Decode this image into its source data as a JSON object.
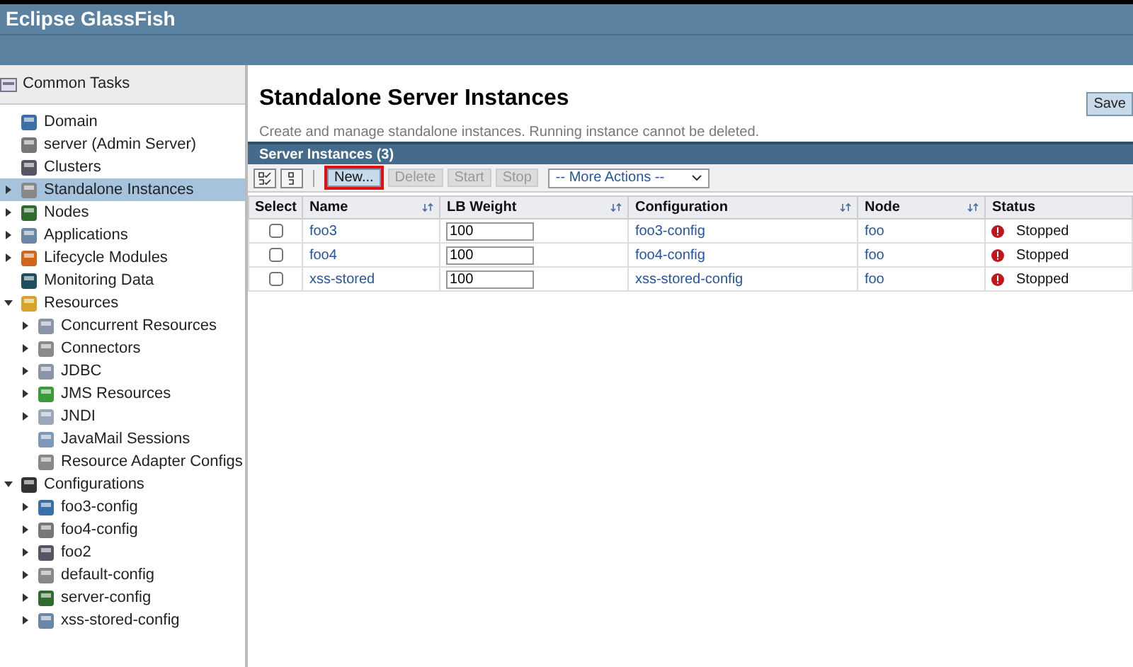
{
  "header": {
    "title": "Eclipse GlassFish"
  },
  "sidebar": {
    "title": "Common Tasks",
    "items": [
      {
        "label": "Domain",
        "kind": "leaf",
        "selected": false
      },
      {
        "label": "server (Admin Server)",
        "kind": "leaf",
        "selected": false
      },
      {
        "label": "Clusters",
        "kind": "leaf",
        "selected": false
      },
      {
        "label": "Standalone Instances",
        "kind": "node",
        "expanded": false,
        "selected": true
      },
      {
        "label": "Nodes",
        "kind": "node",
        "expanded": false,
        "selected": false
      },
      {
        "label": "Applications",
        "kind": "node",
        "expanded": false,
        "selected": false
      },
      {
        "label": "Lifecycle Modules",
        "kind": "node",
        "expanded": false,
        "selected": false
      },
      {
        "label": "Monitoring Data",
        "kind": "leaf",
        "selected": false
      },
      {
        "label": "Resources",
        "kind": "node",
        "expanded": true,
        "selected": false,
        "children": [
          {
            "label": "Concurrent Resources",
            "kind": "node",
            "expanded": false,
            "selected": false
          },
          {
            "label": "Connectors",
            "kind": "node",
            "expanded": false,
            "selected": false
          },
          {
            "label": "JDBC",
            "kind": "node",
            "expanded": false,
            "selected": false
          },
          {
            "label": "JMS Resources",
            "kind": "node",
            "expanded": false,
            "selected": false
          },
          {
            "label": "JNDI",
            "kind": "node",
            "expanded": false,
            "selected": false
          },
          {
            "label": "JavaMail Sessions",
            "kind": "leaf",
            "selected": false
          },
          {
            "label": "Resource Adapter Configs",
            "kind": "leaf",
            "selected": false
          }
        ]
      },
      {
        "label": "Configurations",
        "kind": "node",
        "expanded": true,
        "selected": false,
        "children": [
          {
            "label": "foo3-config",
            "kind": "node",
            "expanded": false,
            "selected": false
          },
          {
            "label": "foo4-config",
            "kind": "node",
            "expanded": false,
            "selected": false
          },
          {
            "label": "foo2",
            "kind": "node",
            "expanded": false,
            "selected": false
          },
          {
            "label": "default-config",
            "kind": "node",
            "expanded": false,
            "selected": false
          },
          {
            "label": "server-config",
            "kind": "node",
            "expanded": false,
            "selected": false
          },
          {
            "label": "xss-stored-config",
            "kind": "node",
            "expanded": false,
            "selected": false
          }
        ]
      }
    ]
  },
  "page": {
    "title": "Standalone Server Instances",
    "description": "Create and manage standalone instances. Running instance cannot be deleted.",
    "save_button": "Save"
  },
  "table": {
    "title": "Server Instances (3)",
    "toolbar": [
      {
        "label": "New...",
        "disabled": false,
        "highlighted": true
      },
      {
        "label": "Delete",
        "disabled": true,
        "highlighted": false
      },
      {
        "label": "Start",
        "disabled": true,
        "highlighted": false
      },
      {
        "label": "Stop",
        "disabled": true,
        "highlighted": false
      }
    ],
    "more_actions": "-- More Actions --",
    "columns": [
      {
        "label": "Select",
        "sortable": false
      },
      {
        "label": "Name",
        "sortable": true
      },
      {
        "label": "LB Weight",
        "sortable": true
      },
      {
        "label": "Configuration",
        "sortable": true
      },
      {
        "label": "Node",
        "sortable": true
      },
      {
        "label": "Status",
        "sortable": false
      }
    ],
    "rows": [
      {
        "checked": false,
        "name": "foo3",
        "lb_weight": "100",
        "configuration": "foo3-config",
        "node": "foo",
        "status": "Stopped"
      },
      {
        "checked": false,
        "name": "foo4",
        "lb_weight": "100",
        "configuration": "foo4-config",
        "node": "foo",
        "status": "Stopped"
      },
      {
        "checked": false,
        "name": "xss-stored",
        "lb_weight": "100",
        "configuration": "xss-stored-config",
        "node": "foo",
        "status": "Stopped"
      }
    ]
  }
}
